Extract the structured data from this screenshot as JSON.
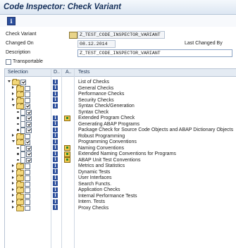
{
  "window": {
    "title": "Code Inspector: Check Variant"
  },
  "toolbar": {
    "info_icon": "info-icon"
  },
  "form": {
    "check_variant_label": "Check Variant",
    "check_variant_value": "Z_TEST_CODE_INSPECTOR_VARIANT",
    "changed_on_label": "Changed On",
    "changed_on_value": "08.12.2014",
    "last_changed_by_label": "Last Changed By",
    "description_label": "Description",
    "description_value": "Z_TEST_CODE_INSPECTOR_VARIANT",
    "transportable_label": "Transportable",
    "transportable_checked": false
  },
  "grid": {
    "headers": {
      "selection": "Selection",
      "doc": "D..",
      "attr": "A..",
      "tests": "Tests"
    },
    "rows": [
      {
        "text": "List of Checks",
        "level": 0,
        "expander": "down",
        "checked": true,
        "info": true,
        "attr": false,
        "kind": "folder"
      },
      {
        "text": "General Checks",
        "level": 1,
        "expander": "right",
        "checked": false,
        "info": true,
        "attr": false,
        "kind": "folder"
      },
      {
        "text": "Performance Checks",
        "level": 1,
        "expander": "right",
        "checked": false,
        "info": true,
        "attr": false,
        "kind": "folder"
      },
      {
        "text": "Security Checks",
        "level": 1,
        "expander": "right",
        "checked": false,
        "info": true,
        "attr": false,
        "kind": "folder"
      },
      {
        "text": "Syntax Check/Generation",
        "level": 1,
        "expander": "down",
        "checked": true,
        "info": true,
        "attr": false,
        "kind": "folder"
      },
      {
        "text": "Syntax Check",
        "level": 2,
        "expander": "bullet",
        "checked": true,
        "info": false,
        "attr": false,
        "kind": "doc"
      },
      {
        "text": "Extended Program Check",
        "level": 2,
        "expander": "bullet",
        "checked": true,
        "info": true,
        "attr": true,
        "kind": "doc"
      },
      {
        "text": "Generating ABAP Programs",
        "level": 2,
        "expander": "bullet",
        "checked": true,
        "info": true,
        "attr": false,
        "kind": "doc"
      },
      {
        "text": "Package Check for Source Code Objects and ABAP Dictionary Objects",
        "level": 2,
        "expander": "bullet",
        "checked": true,
        "info": true,
        "attr": false,
        "kind": "doc"
      },
      {
        "text": "Robust Programming",
        "level": 1,
        "expander": "right",
        "checked": false,
        "info": true,
        "attr": false,
        "kind": "folder"
      },
      {
        "text": "Programming Conventions",
        "level": 1,
        "expander": "down",
        "checked": true,
        "info": true,
        "attr": false,
        "kind": "folder"
      },
      {
        "text": "Naming Conventions",
        "level": 2,
        "expander": "bullet",
        "checked": true,
        "info": true,
        "attr": true,
        "kind": "doc"
      },
      {
        "text": "Extended Naming Conventions for Programs",
        "level": 2,
        "expander": "bullet",
        "checked": true,
        "info": true,
        "attr": true,
        "kind": "doc"
      },
      {
        "text": "ABAP Unit Test Conventions",
        "level": 2,
        "expander": "bullet",
        "checked": true,
        "info": true,
        "attr": true,
        "kind": "doc"
      },
      {
        "text": "Metrics and Statistics",
        "level": 1,
        "expander": "right",
        "checked": false,
        "info": true,
        "attr": false,
        "kind": "folder"
      },
      {
        "text": "Dynamic Tests",
        "level": 1,
        "expander": "right",
        "checked": false,
        "info": true,
        "attr": false,
        "kind": "folder"
      },
      {
        "text": "User Interfaces",
        "level": 1,
        "expander": "right",
        "checked": false,
        "info": true,
        "attr": false,
        "kind": "folder"
      },
      {
        "text": "Search Functs.",
        "level": 1,
        "expander": "right",
        "checked": false,
        "info": true,
        "attr": false,
        "kind": "folder"
      },
      {
        "text": "Application Checks",
        "level": 1,
        "expander": "right",
        "checked": false,
        "info": true,
        "attr": false,
        "kind": "folder"
      },
      {
        "text": "Internal Performance Tests",
        "level": 1,
        "expander": "right",
        "checked": false,
        "info": true,
        "attr": false,
        "kind": "folder"
      },
      {
        "text": "Intern. Tests",
        "level": 1,
        "expander": "right",
        "checked": false,
        "info": true,
        "attr": false,
        "kind": "folder"
      },
      {
        "text": "Proxy Checks",
        "level": 1,
        "expander": "right",
        "checked": false,
        "info": true,
        "attr": false,
        "kind": "folder"
      }
    ]
  }
}
